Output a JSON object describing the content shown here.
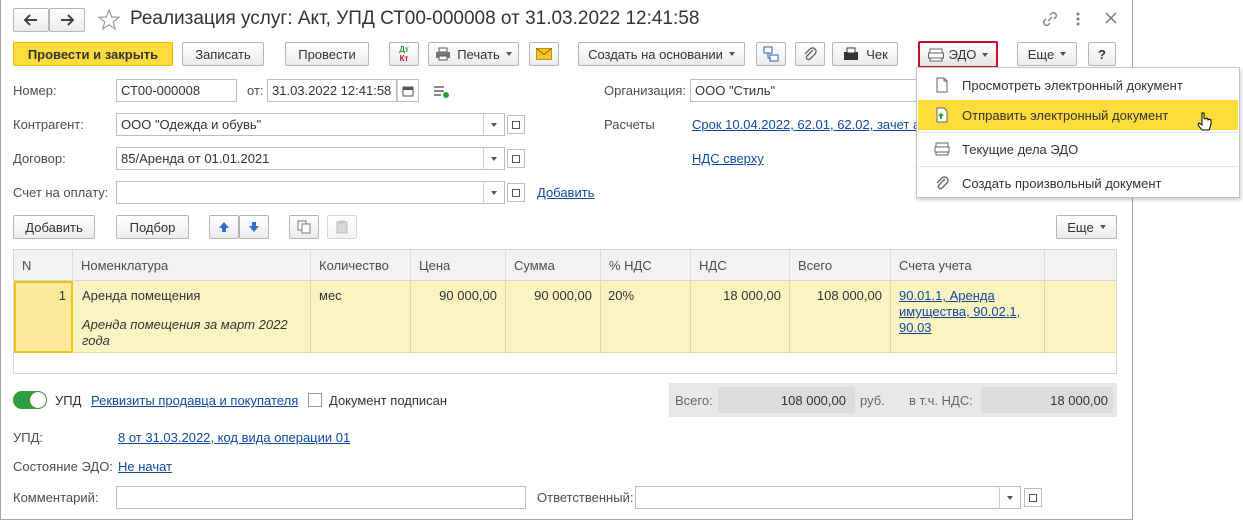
{
  "window": {
    "title": "Реализация услуг: Акт, УПД СТ00-000008 от 31.03.2022 12:41:58"
  },
  "toolbar": {
    "post_close": "Провести и закрыть",
    "write": "Записать",
    "post": "Провести",
    "dtkt_dt": "Дт",
    "dtkt_kt": "Кт",
    "print": "Печать",
    "create_based": "Создать на основании",
    "check": "Чек",
    "edo": "ЭДО",
    "more": "Еще",
    "help": "?"
  },
  "edo_menu": {
    "items": [
      {
        "label": "Просмотреть электронный документ",
        "icon": "document-icon"
      },
      {
        "label": "Отправить электронный документ",
        "icon": "send-document-icon"
      },
      {
        "label": "Текущие дела ЭДО",
        "icon": "edo-tasks-icon"
      },
      {
        "label": "Создать произвольный документ",
        "icon": "paperclip-icon"
      }
    ],
    "highlighted_index": 1
  },
  "form": {
    "number_label": "Номер:",
    "number_value": "СТ00-000008",
    "from_label": "от:",
    "date_value": "31.03.2022 12:41:58",
    "org_label": "Организация:",
    "org_value": "ООО \"Стиль\"",
    "counterparty_label": "Контрагент:",
    "counterparty_value": "ООО \"Одежда и обувь\"",
    "settlements_label": "Расчеты",
    "settlements_link": "Срок 10.04.2022, 62.01, 62.02, зачет а",
    "contract_label": "Договор:",
    "contract_value": "85/Аренда от 01.01.2021",
    "vat_link": "НДС сверху",
    "invoice_label": "Счет на оплату:",
    "invoice_value": "",
    "add_link": "Добавить"
  },
  "table_toolbar": {
    "add": "Добавить",
    "pick": "Подбор",
    "more": "Еще"
  },
  "table": {
    "columns": [
      "N",
      "Номенклатура",
      "Количество",
      "Цена",
      "Сумма",
      "% НДС",
      "НДС",
      "Всего",
      "Счета учета"
    ],
    "rows": [
      {
        "n": "1",
        "item": "Аренда помещения",
        "item_desc_1": "Аренда помещения за март 2022",
        "item_desc_2": "года",
        "qty": "мес",
        "price": "90 000,00",
        "sum": "90 000,00",
        "vat_rate": "20%",
        "vat": "18 000,00",
        "total": "108 000,00",
        "accounts_1": "90.01.1, Аренда",
        "accounts_2": "имущества, 90.02.1,",
        "accounts_3": "90.03"
      }
    ]
  },
  "footer": {
    "upd_toggle": "УПД",
    "requisites_link": "Реквизиты продавца и покупателя",
    "signed_label": "Документ подписан",
    "total_label": "Всего:",
    "total_value": "108 000,00",
    "currency": "руб.",
    "incl_vat_label": "в т.ч. НДС:",
    "incl_vat_value": "18 000,00",
    "upd_label": "УПД:",
    "upd_link": "8 от 31.03.2022, код вида операции 01",
    "edo_state_label": "Состояние ЭДО:",
    "edo_state_link": "Не начат",
    "comment_label": "Комментарий:",
    "comment_value": "",
    "responsible_label": "Ответственный:",
    "responsible_value": ""
  },
  "colors": {
    "accent_yellow": "#fedc3c",
    "row_highlight": "#fcf3c2",
    "link": "#0f4a9e",
    "toggle_green": "#2e9d3e",
    "edo_button_border": "#c8102e"
  }
}
